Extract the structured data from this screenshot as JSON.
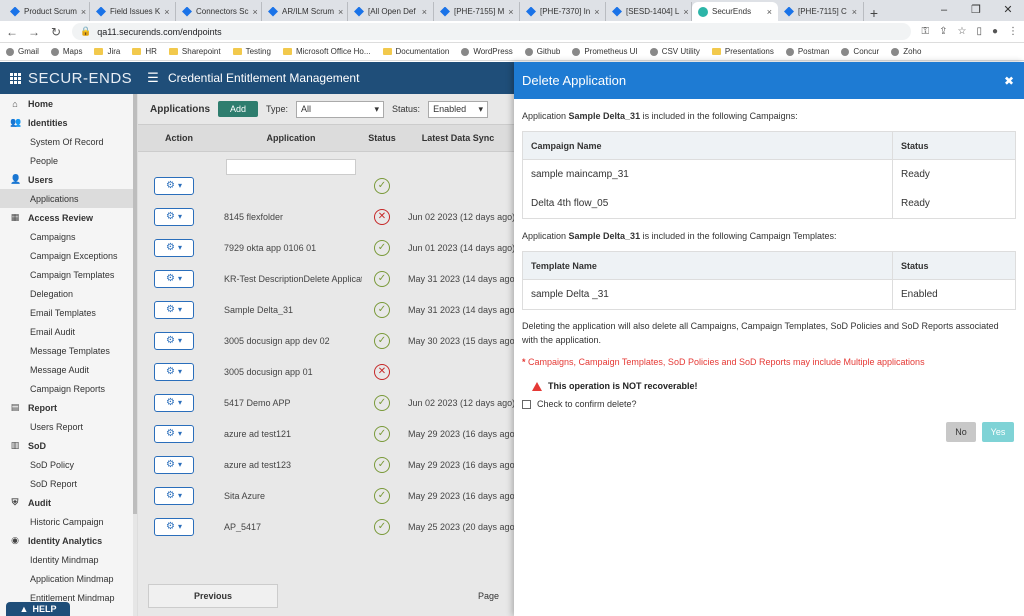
{
  "browser": {
    "tabs": [
      {
        "title": "Product Scrum"
      },
      {
        "title": "Field Issues K"
      },
      {
        "title": "Connectors Sc"
      },
      {
        "title": "AR/ILM Scrum"
      },
      {
        "title": "[All Open Def"
      },
      {
        "title": "[PHE-7155] M"
      },
      {
        "title": "[PHE-7370] In"
      },
      {
        "title": "[SESD-1404] L"
      },
      {
        "title": "SecurEnds"
      },
      {
        "title": "[PHE-7115] C"
      }
    ],
    "url": "qa11.securends.com/endpoints",
    "bookmarks": [
      "Gmail",
      "Maps",
      "Jira",
      "HR",
      "Sharepoint",
      "Testing",
      "Microsoft Office Ho...",
      "Documentation",
      "WordPress",
      "Github",
      "Prometheus UI",
      "CSV Utility",
      "Presentations",
      "Postman",
      "Concur",
      "Zoho"
    ]
  },
  "app": {
    "logo": "SECUR-ENDS",
    "title": "Credential Entitlement Management"
  },
  "sidebar": {
    "items": [
      {
        "label": "Home",
        "section": true,
        "icon": "home-icon",
        "glyph": "⌂"
      },
      {
        "label": "Identities",
        "section": true,
        "icon": "users-icon",
        "glyph": "👥"
      },
      {
        "label": "System Of Record"
      },
      {
        "label": "People"
      },
      {
        "label": "Users",
        "section": true,
        "icon": "user-icon",
        "glyph": "👤"
      },
      {
        "label": "Applications",
        "active": true
      },
      {
        "label": "Access Review",
        "section": true,
        "icon": "grid-icon",
        "glyph": "▦"
      },
      {
        "label": "Campaigns"
      },
      {
        "label": "Campaign Exceptions"
      },
      {
        "label": "Campaign Templates"
      },
      {
        "label": "Delegation"
      },
      {
        "label": "Email Templates"
      },
      {
        "label": "Email Audit"
      },
      {
        "label": "Message Templates"
      },
      {
        "label": "Message Audit"
      },
      {
        "label": "Campaign Reports"
      },
      {
        "label": "Report",
        "section": true,
        "icon": "report-icon",
        "glyph": "▤"
      },
      {
        "label": "Users Report"
      },
      {
        "label": "SoD",
        "section": true,
        "icon": "sod-icon",
        "glyph": "▥"
      },
      {
        "label": "SoD Policy"
      },
      {
        "label": "SoD Report"
      },
      {
        "label": "Audit",
        "section": true,
        "icon": "shield-icon",
        "glyph": "⛨"
      },
      {
        "label": "Historic Campaign"
      },
      {
        "label": "Identity Analytics",
        "section": true,
        "icon": "analytics-icon",
        "glyph": "◉"
      },
      {
        "label": "Identity Mindmap"
      },
      {
        "label": "Application Mindmap"
      },
      {
        "label": "Entitlement Mindmap"
      }
    ],
    "help": "HELP"
  },
  "content": {
    "heading": "Applications",
    "add": "Add",
    "type_label": "Type:",
    "type_value": "All",
    "status_label": "Status:",
    "status_value": "Enabled",
    "columns": {
      "action": "Action",
      "application": "Application",
      "status": "Status",
      "sync": "Latest Data Sync"
    },
    "rows": [
      {
        "app": "",
        "status": "ok",
        "sync": ""
      },
      {
        "app": "8145 flexfolder",
        "status": "err",
        "sync": "Jun 02 2023 (12 days ago)"
      },
      {
        "app": "7929 okta app 0106 01",
        "status": "ok",
        "sync": "Jun 01 2023 (14 days ago)"
      },
      {
        "app": "KR-Test DescriptionDelete Applicat",
        "status": "ok",
        "sync": "May 31 2023 (14 days ago)"
      },
      {
        "app": "Sample Delta_31",
        "status": "ok",
        "sync": "May 31 2023 (14 days ago)"
      },
      {
        "app": "3005 docusign app dev 02",
        "status": "ok",
        "sync": "May 30 2023 (15 days ago)"
      },
      {
        "app": "3005 docusign app 01",
        "status": "err",
        "sync": ""
      },
      {
        "app": "5417 Demo APP",
        "status": "ok",
        "sync": "Jun 02 2023 (12 days ago)"
      },
      {
        "app": "azure ad test121",
        "status": "ok",
        "sync": "May 29 2023 (16 days ago)"
      },
      {
        "app": "azure ad test123",
        "status": "ok",
        "sync": "May 29 2023 (16 days ago)"
      },
      {
        "app": "Sita Azure",
        "status": "ok",
        "sync": "May 29 2023 (16 days ago)"
      },
      {
        "app": "AP_5417",
        "status": "ok",
        "sync": "May 25 2023 (20 days ago)"
      }
    ],
    "previous": "Previous",
    "page": "Page"
  },
  "modal": {
    "title": "Delete Application",
    "intro1_pre": "Application ",
    "app_name": "Sample Delta_31",
    "intro1_post": " is included in the following Campaigns:",
    "campaign_cols": {
      "name": "Campaign Name",
      "status": "Status"
    },
    "campaigns": [
      {
        "name": "sample maincamp_31",
        "status": "Ready"
      },
      {
        "name": "Delta 4th flow_05",
        "status": "Ready"
      }
    ],
    "intro2_post": " is included in the following Campaign Templates:",
    "template_cols": {
      "name": "Template Name",
      "status": "Status"
    },
    "templates": [
      {
        "name": "sample Delta _31",
        "status": "Enabled"
      }
    ],
    "note": "Deleting the application will also delete all Campaigns, Campaign Templates, SoD Policies and SoD Reports associated with the application.",
    "warning": "Campaigns, Campaign Templates, SoD Policies and SoD Reports may include Multiple applications",
    "not_recoverable": "This operation is NOT recoverable!",
    "confirm": "Check to confirm delete?",
    "no": "No",
    "yes": "Yes"
  },
  "colors": {
    "topbar": "#1f4e79",
    "modal_header": "#1e7bd3",
    "warning": "#e53935",
    "yes_button": "#7fd3d6"
  }
}
